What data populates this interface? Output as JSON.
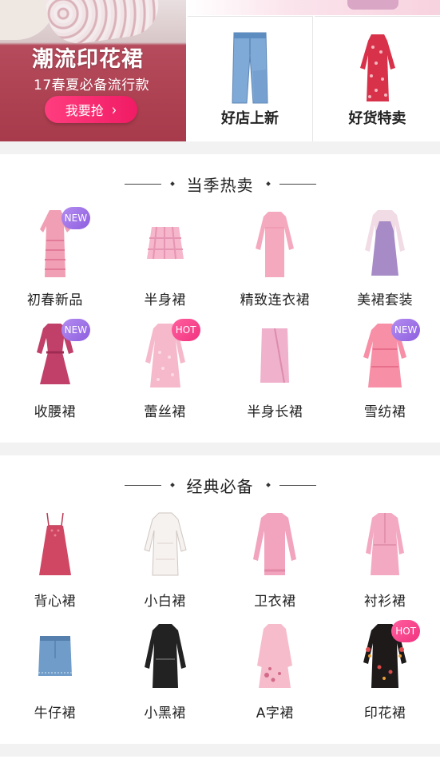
{
  "banner": {
    "title": "潮流印花裙",
    "subtitle": "17春夏必备流行款",
    "cta": "我要抢",
    "cta_icon": "chevron-right-icon"
  },
  "tiles": [
    {
      "label": "好店上新",
      "icon": "jeans-icon"
    },
    {
      "label": "好货特卖",
      "icon": "red-floral-dress-icon"
    }
  ],
  "sections": [
    {
      "title": "当季热卖",
      "items": [
        {
          "label": "初春新品",
          "badge": "NEW",
          "icon": "pink-lace-dress-icon"
        },
        {
          "label": "半身裙",
          "badge": "",
          "icon": "plaid-skirt-icon"
        },
        {
          "label": "精致连衣裙",
          "badge": "",
          "icon": "pink-sleeve-dress-icon"
        },
        {
          "label": "美裙套装",
          "badge": "",
          "icon": "blouse-pinafore-set-icon"
        },
        {
          "label": "收腰裙",
          "badge": "NEW",
          "icon": "wrap-waist-dress-icon"
        },
        {
          "label": "蕾丝裙",
          "badge": "HOT",
          "icon": "lace-smock-dress-icon"
        },
        {
          "label": "半身长裙",
          "badge": "",
          "icon": "wrap-midi-skirt-icon"
        },
        {
          "label": "雪纺裙",
          "badge": "NEW",
          "icon": "chiffon-dress-icon"
        }
      ]
    },
    {
      "title": "经典必备",
      "items": [
        {
          "label": "背心裙",
          "badge": "",
          "icon": "slip-dress-icon"
        },
        {
          "label": "小白裙",
          "badge": "",
          "icon": "white-dress-icon"
        },
        {
          "label": "卫衣裙",
          "badge": "",
          "icon": "sweatshirt-dress-icon"
        },
        {
          "label": "衬衫裙",
          "badge": "",
          "icon": "shirt-dress-icon"
        },
        {
          "label": "牛仔裙",
          "badge": "",
          "icon": "denim-skirt-icon"
        },
        {
          "label": "小黑裙",
          "badge": "",
          "icon": "black-dress-icon"
        },
        {
          "label": "A字裙",
          "badge": "",
          "icon": "a-line-dress-icon"
        },
        {
          "label": "印花裙",
          "badge": "HOT",
          "icon": "printed-dress-icon"
        }
      ]
    }
  ]
}
